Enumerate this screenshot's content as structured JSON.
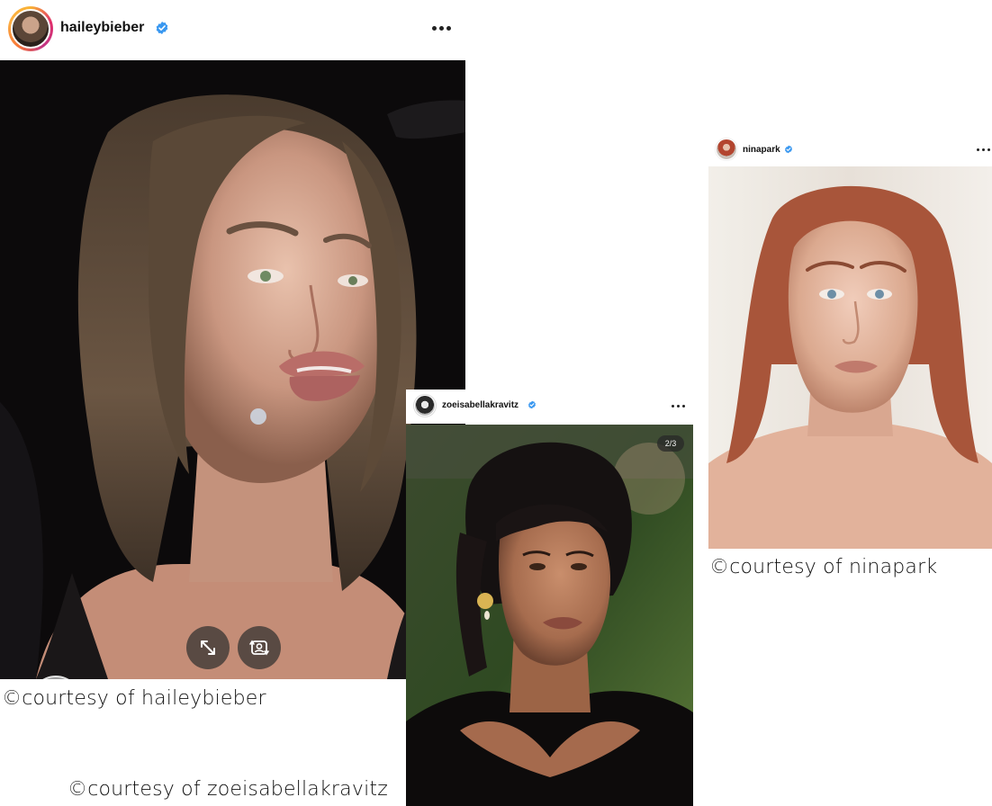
{
  "posts": [
    {
      "username": "haileybieber",
      "verified": true,
      "menu_icon": "more-horizontal-icon",
      "overlay_buttons": [
        "expand-icon",
        "switch-camera-icon"
      ],
      "credit": "©courtesy of haileybieber"
    },
    {
      "username": "zoeisabellakravitz",
      "verified": true,
      "menu_icon": "more-horizontal-icon",
      "carousel_counter": "2/3",
      "credit": "©courtesy of zoeisabellakravitz"
    },
    {
      "username": "ninapark",
      "verified": true,
      "menu_icon": "more-horizontal-icon",
      "credit": "©courtesy of ninapark"
    }
  ],
  "colors": {
    "verified_blue": "#3897f0",
    "story_ring": [
      "#f9b233",
      "#e1306c",
      "#c13584"
    ],
    "heart": "#ff3b5c"
  }
}
